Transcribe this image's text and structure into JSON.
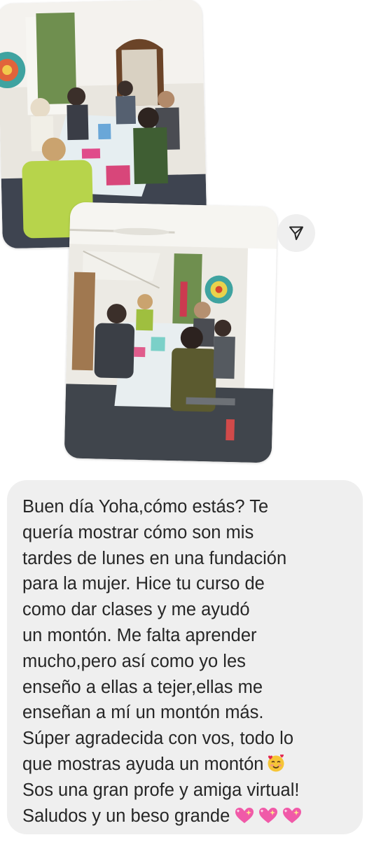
{
  "message": {
    "lines": [
      "Buen día Yoha,cómo estás? Te",
      "quería mostrar cómo son mis",
      "tardes de lunes en una fundación",
      "para la mujer. Hice tu curso de",
      "como dar clases y me ayudó",
      "un montón. Me falta aprender",
      "mucho,pero así como yo les",
      "enseño a ellas a tejer,ellas me",
      "enseñan a mí un montón más.",
      "Súper agradecida con vos, todo lo",
      "que mostras ayuda un montón",
      "Sos una gran profe y amiga virtual!",
      "Saludos y un beso grande"
    ],
    "emojis": {
      "line_11": "smiling-face-with-hearts",
      "line_13": [
        "sparkling-heart",
        "sparkling-heart",
        "sparkling-heart"
      ]
    }
  },
  "icons": {
    "share": "send-arrow-icon"
  },
  "colors": {
    "bubble_background": "#efefef",
    "text": "#262626",
    "share_button_background": "#efefef"
  }
}
